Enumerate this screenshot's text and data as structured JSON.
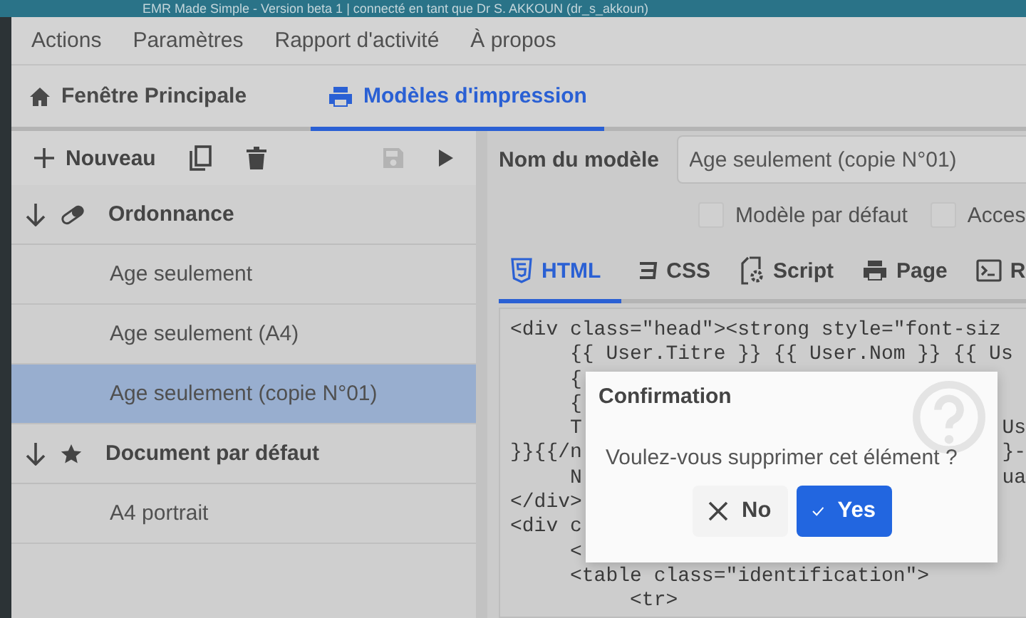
{
  "window": {
    "title": "EMR Made Simple - Version beta 1 | connecté en tant que Dr S. AKKOUN (dr_s_akkoun)"
  },
  "menu": [
    "Actions",
    "Paramètres",
    "Rapport d'activité",
    "À propos"
  ],
  "tabs": [
    {
      "label": "Fenêtre Principale",
      "selected": false
    },
    {
      "label": "Modèles d'impression",
      "selected": true
    }
  ],
  "toolbar": {
    "new_label": "Nouveau",
    "save_disabled": true
  },
  "tree": [
    {
      "label": "Ordonnance",
      "expanded": true,
      "children": [
        {
          "label": "Age seulement",
          "selected": false
        },
        {
          "label": "Age seulement (A4)",
          "selected": false
        },
        {
          "label": "Age seulement (copie N°01)",
          "selected": true
        }
      ]
    },
    {
      "label": "Document par défaut",
      "expanded": true,
      "children": [
        {
          "label": "A4 portrait",
          "selected": false
        }
      ]
    }
  ],
  "editor": {
    "name_label": "Nom du modèle",
    "name_value": "Age seulement (copie N°01)",
    "checkboxes": [
      {
        "label": "Modèle par défaut",
        "checked": false
      },
      {
        "label": "Acces",
        "checked": false
      }
    ],
    "tabs": [
      {
        "label": "HTML",
        "selected": true
      },
      {
        "label": "CSS",
        "selected": false
      },
      {
        "label": "Script",
        "selected": false
      },
      {
        "label": "Page",
        "selected": false
      },
      {
        "label": "R",
        "selected": false
      }
    ],
    "code_lines": [
      {
        "text": "<div class=\"head\"><strong style=\"font-siz"
      },
      {
        "text": "     {{ User.Titre }} {{ User.Nom }} {{ Us"
      },
      {
        "text": "     {"
      },
      {
        "text": "     {"
      },
      {
        "text": "     T",
        "tail": "Us"
      },
      {
        "text": "}}{{/n",
        "tail": "}-"
      },
      {
        "text": "     N",
        "tail": "ua"
      },
      {
        "text": "</div>"
      },
      {
        "text": "<div c"
      },
      {
        "text": "     <"
      },
      {
        "text": "     <table class=\"identification\">"
      },
      {
        "text": "          <tr>"
      }
    ]
  },
  "dialog": {
    "title": "Confirmation",
    "message": "Voulez-vous supprimer cet élément ?",
    "buttons": [
      {
        "label": "No",
        "kind": "cancel"
      },
      {
        "label": "Yes",
        "kind": "confirm"
      }
    ]
  }
}
